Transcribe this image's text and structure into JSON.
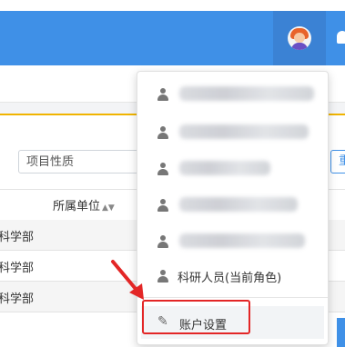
{
  "header": {
    "avatar_icon": "user-avatar-icon",
    "bell_icon": "bell-icon",
    "accent": "#3f90e7"
  },
  "filters": {
    "project_nature_placeholder": "项目性质",
    "right_button_label": "重"
  },
  "table": {
    "column_header": "所属单位",
    "sort_icon": "sort-icon",
    "rows": [
      {
        "unit": "科学部"
      },
      {
        "unit": "科学部"
      },
      {
        "unit": "科学部"
      }
    ]
  },
  "dropdown": {
    "blurred_items_count": 5,
    "role_item_label": "科研人员(当前角色)",
    "settings_label": "账户设置"
  },
  "annotation": {
    "highlight_color": "#e32626"
  }
}
